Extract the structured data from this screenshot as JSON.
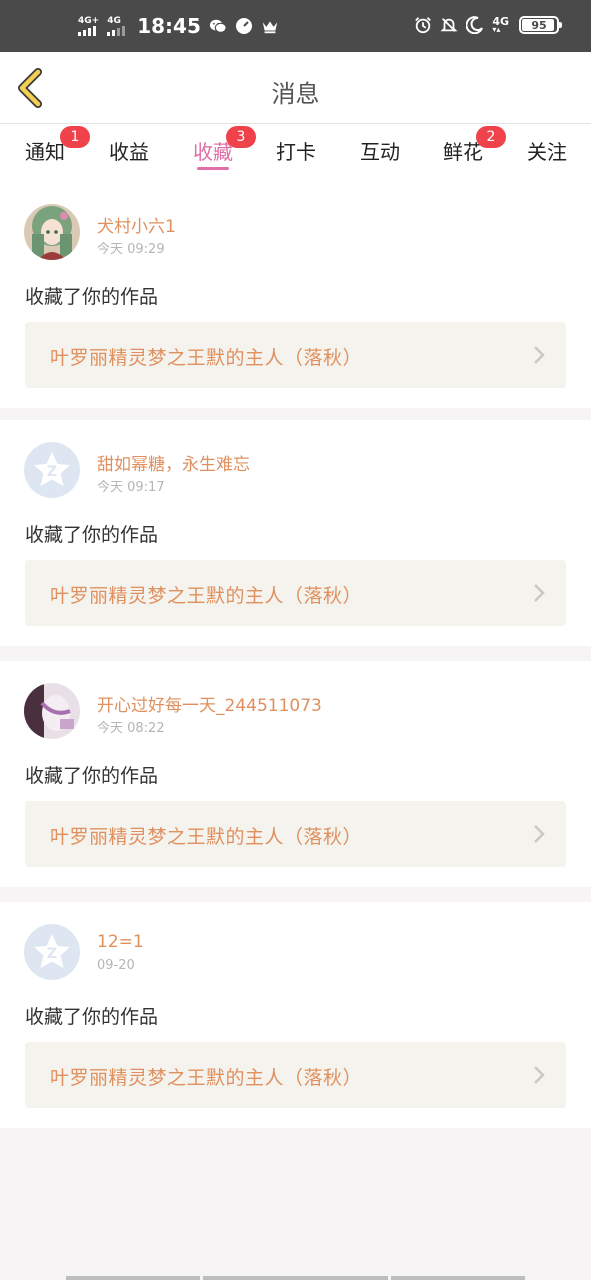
{
  "status_bar": {
    "signal1_label": "4G+",
    "signal2_label": "4G",
    "time": "18:45",
    "network_label": "4G",
    "battery": "95",
    "battery_level": 0.95
  },
  "header": {
    "title": "消息"
  },
  "tabs": [
    {
      "label": "通知",
      "badge": "1"
    },
    {
      "label": "收益",
      "badge": ""
    },
    {
      "label": "收藏",
      "badge": "3",
      "active": true
    },
    {
      "label": "打卡",
      "badge": ""
    },
    {
      "label": "互动",
      "badge": ""
    },
    {
      "label": "鲜花",
      "badge": "2"
    },
    {
      "label": "关注",
      "badge": ""
    }
  ],
  "messages": [
    {
      "user": "犬村小六1",
      "time": "今天 09:29",
      "action": "收藏了你的作品",
      "work": "叶罗丽精灵梦之王默的主人（落秋）",
      "avatar": "anime-girl-avatar"
    },
    {
      "user": "甜如幂糖，永生难忘",
      "time": "今天 09:17",
      "action": "收藏了你的作品",
      "work": "叶罗丽精灵梦之王默的主人（落秋）",
      "avatar": "default-avatar"
    },
    {
      "user": "开心过好每一天_244511073",
      "time": "今天 08:22",
      "action": "收藏了你的作品",
      "work": "叶罗丽精灵梦之王默的主人（落秋）",
      "avatar": "photo-avatar"
    },
    {
      "user": "12=1",
      "time": "09-20",
      "action": "收藏了你的作品",
      "work": "叶罗丽精灵梦之王默的主人（落秋）",
      "avatar": "default-avatar"
    }
  ],
  "colors": {
    "accent": "#e06ea8",
    "username": "#e0905f",
    "badge": "#f0424a",
    "back_arrow": "#f2cf54"
  }
}
